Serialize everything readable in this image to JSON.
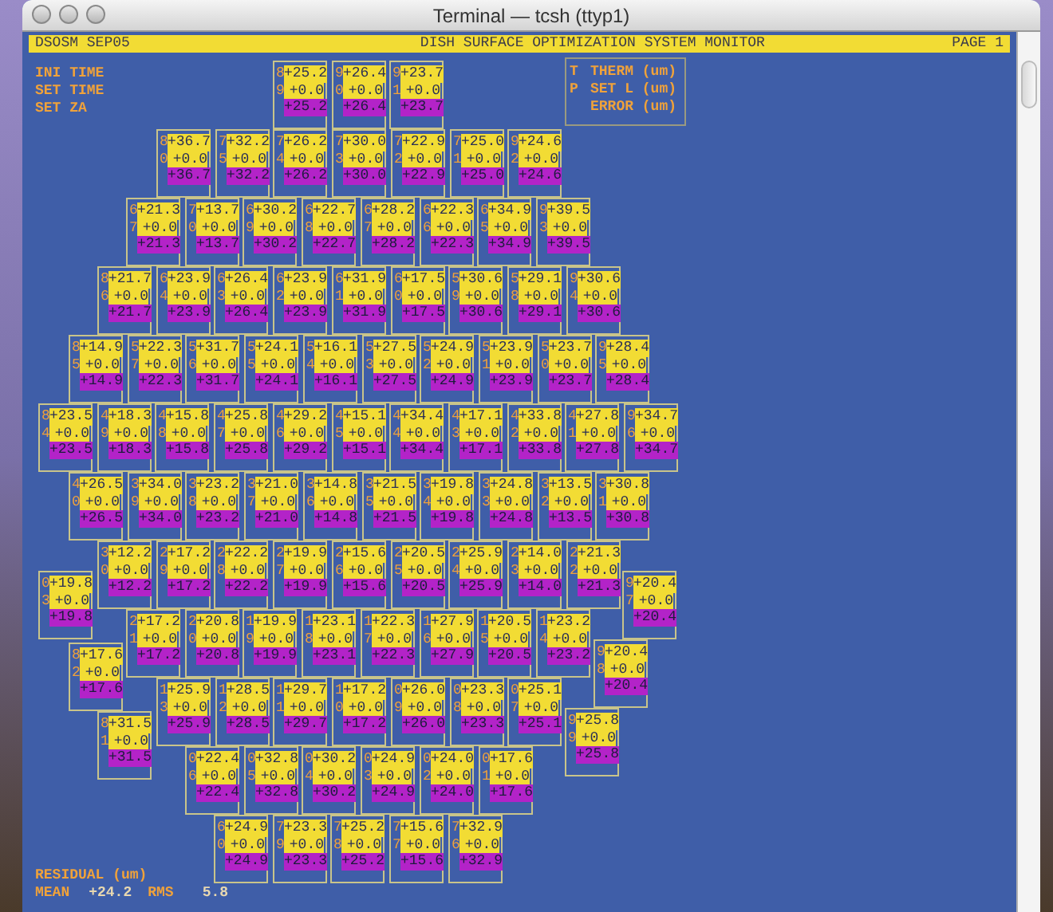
{
  "window": {
    "title": "Terminal — tcsh (ttyp1)"
  },
  "header": {
    "left": "DSOSM SEP05",
    "title": "DISH SURFACE OPTIMIZATION SYSTEM MONITOR",
    "page": "PAGE 1"
  },
  "info_labels": [
    "INI TIME",
    "SET TIME",
    "SET ZA"
  ],
  "legend": [
    {
      "key": "T",
      "label": "THERM (um)"
    },
    {
      "key": "P",
      "label": "SET L (um)"
    },
    {
      "label": "ERROR (um)"
    }
  ],
  "panel_rows": [
    [
      {
        "t": "8",
        "p": "9",
        "therm": "+25.2",
        "set": "+0.0",
        "error": "+25.2"
      },
      {
        "t": "9",
        "p": "0",
        "therm": "+26.4",
        "set": "+0.0",
        "error": "+26.4"
      },
      {
        "t": "9",
        "p": "1",
        "therm": "+23.7",
        "set": "+0.0",
        "error": "+23.7"
      }
    ],
    [
      {
        "t": "8",
        "p": "0",
        "therm": "+36.7",
        "set": "+0.0",
        "error": "+36.7"
      },
      {
        "t": "7",
        "p": "5",
        "therm": "+32.2",
        "set": "+0.0",
        "error": "+32.2"
      },
      {
        "t": "7",
        "p": "4",
        "therm": "+26.2",
        "set": "+0.0",
        "error": "+26.2"
      },
      {
        "t": "7",
        "p": "3",
        "therm": "+30.0",
        "set": "+0.0",
        "error": "+30.0"
      },
      {
        "t": "7",
        "p": "2",
        "therm": "+22.9",
        "set": "+0.0",
        "error": "+22.9"
      },
      {
        "t": "7",
        "p": "1",
        "therm": "+25.0",
        "set": "+0.0",
        "error": "+25.0"
      },
      {
        "t": "9",
        "p": "2",
        "therm": "+24.6",
        "set": "+0.0",
        "error": "+24.6"
      }
    ],
    [
      {
        "t": "6",
        "p": "7",
        "therm": "+21.3",
        "set": "+0.0",
        "error": "+21.3"
      },
      {
        "t": "7",
        "p": "0",
        "therm": "+13.7",
        "set": "+0.0",
        "error": "+13.7"
      },
      {
        "t": "6",
        "p": "9",
        "therm": "+30.2",
        "set": "+0.0",
        "error": "+30.2"
      },
      {
        "t": "6",
        "p": "8",
        "therm": "+22.7",
        "set": "+0.0",
        "error": "+22.7"
      },
      {
        "t": "6",
        "p": "7",
        "therm": "+28.2",
        "set": "+0.0",
        "error": "+28.2"
      },
      {
        "t": "6",
        "p": "6",
        "therm": "+22.3",
        "set": "+0.0",
        "error": "+22.3"
      },
      {
        "t": "6",
        "p": "5",
        "therm": "+34.9",
        "set": "+0.0",
        "error": "+34.9"
      },
      {
        "t": "9",
        "p": "3",
        "therm": "+39.5",
        "set": "+0.0",
        "error": "+39.5"
      }
    ],
    [
      {
        "t": "8",
        "p": "6",
        "therm": "+21.7",
        "set": "+0.0",
        "error": "+21.7"
      },
      {
        "t": "6",
        "p": "4",
        "therm": "+23.9",
        "set": "+0.0",
        "error": "+23.9"
      },
      {
        "t": "6",
        "p": "3",
        "therm": "+26.4",
        "set": "+0.0",
        "error": "+26.4"
      },
      {
        "t": "6",
        "p": "2",
        "therm": "+23.9",
        "set": "+0.0",
        "error": "+23.9"
      },
      {
        "t": "6",
        "p": "1",
        "therm": "+31.9",
        "set": "+0.0",
        "error": "+31.9"
      },
      {
        "t": "6",
        "p": "0",
        "therm": "+17.5",
        "set": "+0.0",
        "error": "+17.5"
      },
      {
        "t": "5",
        "p": "9",
        "therm": "+30.6",
        "set": "+0.0",
        "error": "+30.6"
      },
      {
        "t": "5",
        "p": "8",
        "therm": "+29.1",
        "set": "+0.0",
        "error": "+29.1"
      },
      {
        "t": "9",
        "p": "4",
        "therm": "+30.6",
        "set": "+0.0",
        "error": "+30.6"
      }
    ],
    [
      {
        "t": "8",
        "p": "5",
        "therm": "+14.9",
        "set": "+0.0",
        "error": "+14.9"
      },
      {
        "t": "5",
        "p": "7",
        "therm": "+22.3",
        "set": "+0.0",
        "error": "+22.3"
      },
      {
        "t": "5",
        "p": "6",
        "therm": "+31.7",
        "set": "+0.0",
        "error": "+31.7"
      },
      {
        "t": "5",
        "p": "5",
        "therm": "+24.1",
        "set": "+0.0",
        "error": "+24.1"
      },
      {
        "t": "5",
        "p": "4",
        "therm": "+16.1",
        "set": "+0.0",
        "error": "+16.1"
      },
      {
        "t": "5",
        "p": "3",
        "therm": "+27.5",
        "set": "+0.0",
        "error": "+27.5"
      },
      {
        "t": "5",
        "p": "2",
        "therm": "+24.9",
        "set": "+0.0",
        "error": "+24.9"
      },
      {
        "t": "5",
        "p": "1",
        "therm": "+23.9",
        "set": "+0.0",
        "error": "+23.9"
      },
      {
        "t": "5",
        "p": "0",
        "therm": "+23.7",
        "set": "+0.0",
        "error": "+23.7"
      },
      {
        "t": "9",
        "p": "5",
        "therm": "+28.4",
        "set": "+0.0",
        "error": "+28.4"
      }
    ],
    [
      {
        "t": "8",
        "p": "4",
        "therm": "+23.5",
        "set": "+0.0",
        "error": "+23.5"
      },
      {
        "t": "4",
        "p": "9",
        "therm": "+18.3",
        "set": "+0.0",
        "error": "+18.3"
      },
      {
        "t": "4",
        "p": "8",
        "therm": "+15.8",
        "set": "+0.0",
        "error": "+15.8"
      },
      {
        "t": "4",
        "p": "7",
        "therm": "+25.8",
        "set": "+0.0",
        "error": "+25.8"
      },
      {
        "t": "4",
        "p": "6",
        "therm": "+29.2",
        "set": "+0.0",
        "error": "+29.2"
      },
      {
        "t": "4",
        "p": "5",
        "therm": "+15.1",
        "set": "+0.0",
        "error": "+15.1"
      },
      {
        "t": "4",
        "p": "4",
        "therm": "+34.4",
        "set": "+0.0",
        "error": "+34.4"
      },
      {
        "t": "4",
        "p": "3",
        "therm": "+17.1",
        "set": "+0.0",
        "error": "+17.1"
      },
      {
        "t": "4",
        "p": "2",
        "therm": "+33.8",
        "set": "+0.0",
        "error": "+33.8"
      },
      {
        "t": "4",
        "p": "1",
        "therm": "+27.8",
        "set": "+0.0",
        "error": "+27.8"
      },
      {
        "t": "9",
        "p": "6",
        "therm": "+34.7",
        "set": "+0.0",
        "error": "+34.7"
      }
    ],
    [
      {
        "t": "4",
        "p": "0",
        "therm": "+26.5",
        "set": "+0.0",
        "error": "+26.5"
      },
      {
        "t": "3",
        "p": "9",
        "therm": "+34.0",
        "set": "+0.0",
        "error": "+34.0"
      },
      {
        "t": "3",
        "p": "8",
        "therm": "+23.2",
        "set": "+0.0",
        "error": "+23.2"
      },
      {
        "t": "3",
        "p": "7",
        "therm": "+21.0",
        "set": "+0.0",
        "error": "+21.0"
      },
      {
        "t": "3",
        "p": "6",
        "therm": "+14.8",
        "set": "+0.0",
        "error": "+14.8"
      },
      {
        "t": "3",
        "p": "5",
        "therm": "+21.5",
        "set": "+0.0",
        "error": "+21.5"
      },
      {
        "t": "3",
        "p": "4",
        "therm": "+19.8",
        "set": "+0.0",
        "error": "+19.8"
      },
      {
        "t": "3",
        "p": "3",
        "therm": "+24.8",
        "set": "+0.0",
        "error": "+24.8"
      },
      {
        "t": "3",
        "p": "2",
        "therm": "+13.5",
        "set": "+0.0",
        "error": "+13.5"
      },
      {
        "t": "3",
        "p": "1",
        "therm": "+30.8",
        "set": "+0.0",
        "error": "+30.8"
      }
    ],
    [
      {
        "t": "3",
        "p": "0",
        "therm": "+12.2",
        "set": "+0.0",
        "error": "+12.2"
      },
      {
        "t": "2",
        "p": "9",
        "therm": "+17.2",
        "set": "+0.0",
        "error": "+17.2"
      },
      {
        "t": "2",
        "p": "8",
        "therm": "+22.2",
        "set": "+0.0",
        "error": "+22.2"
      },
      {
        "t": "2",
        "p": "7",
        "therm": "+19.9",
        "set": "+0.0",
        "error": "+19.9"
      },
      {
        "t": "2",
        "p": "6",
        "therm": "+15.6",
        "set": "+0.0",
        "error": "+15.6"
      },
      {
        "t": "2",
        "p": "5",
        "therm": "+20.5",
        "set": "+0.0",
        "error": "+20.5"
      },
      {
        "t": "2",
        "p": "4",
        "therm": "+25.9",
        "set": "+0.0",
        "error": "+25.9"
      },
      {
        "t": "2",
        "p": "3",
        "therm": "+14.0",
        "set": "+0.0",
        "error": "+14.0"
      },
      {
        "t": "2",
        "p": "2",
        "therm": "+21.3",
        "set": "+0.0",
        "error": "+21.3"
      }
    ],
    [
      {
        "t": "2",
        "p": "1",
        "therm": "+17.2",
        "set": "+0.0",
        "error": "+17.2"
      },
      {
        "t": "2",
        "p": "0",
        "therm": "+20.8",
        "set": "+0.0",
        "error": "+20.8"
      },
      {
        "t": "1",
        "p": "9",
        "therm": "+19.9",
        "set": "+0.0",
        "error": "+19.9"
      },
      {
        "t": "1",
        "p": "8",
        "therm": "+23.1",
        "set": "+0.0",
        "error": "+23.1"
      },
      {
        "t": "1",
        "p": "7",
        "therm": "+22.3",
        "set": "+0.0",
        "error": "+22.3"
      },
      {
        "t": "1",
        "p": "6",
        "therm": "+27.9",
        "set": "+0.0",
        "error": "+27.9"
      },
      {
        "t": "1",
        "p": "5",
        "therm": "+20.5",
        "set": "+0.0",
        "error": "+20.5"
      },
      {
        "t": "1",
        "p": "4",
        "therm": "+23.2",
        "set": "+0.0",
        "error": "+23.2"
      }
    ],
    [
      {
        "t": "1",
        "p": "3",
        "therm": "+25.9",
        "set": "+0.0",
        "error": "+25.9"
      },
      {
        "t": "1",
        "p": "2",
        "therm": "+28.5",
        "set": "+0.0",
        "error": "+28.5"
      },
      {
        "t": "1",
        "p": "1",
        "therm": "+29.7",
        "set": "+0.0",
        "error": "+29.7"
      },
      {
        "t": "1",
        "p": "0",
        "therm": "+17.2",
        "set": "+0.0",
        "error": "+17.2"
      },
      {
        "t": "0",
        "p": "9",
        "therm": "+26.0",
        "set": "+0.0",
        "error": "+26.0"
      },
      {
        "t": "0",
        "p": "8",
        "therm": "+23.3",
        "set": "+0.0",
        "error": "+23.3"
      },
      {
        "t": "0",
        "p": "7",
        "therm": "+25.1",
        "set": "+0.0",
        "error": "+25.1"
      }
    ],
    [
      {
        "t": "0",
        "p": "6",
        "therm": "+22.4",
        "set": "+0.0",
        "error": "+22.4"
      },
      {
        "t": "0",
        "p": "5",
        "therm": "+32.8",
        "set": "+0.0",
        "error": "+32.8"
      },
      {
        "t": "0",
        "p": "4",
        "therm": "+30.2",
        "set": "+0.0",
        "error": "+30.2"
      },
      {
        "t": "0",
        "p": "3",
        "therm": "+24.9",
        "set": "+0.0",
        "error": "+24.9"
      },
      {
        "t": "0",
        "p": "2",
        "therm": "+24.0",
        "set": "+0.0",
        "error": "+24.0"
      },
      {
        "t": "0",
        "p": "1",
        "therm": "+17.6",
        "set": "+0.0",
        "error": "+17.6"
      }
    ],
    [
      {
        "t": "6",
        "p": "0",
        "therm": "+24.9",
        "set": "+0.0",
        "error": "+24.9"
      },
      {
        "t": "7",
        "p": "9",
        "therm": "+23.3",
        "set": "+0.0",
        "error": "+23.3"
      },
      {
        "t": "7",
        "p": "8",
        "therm": "+25.2",
        "set": "+0.0",
        "error": "+25.2"
      },
      {
        "t": "7",
        "p": "7",
        "therm": "+15.6",
        "set": "+0.0",
        "error": "+15.6"
      },
      {
        "t": "7",
        "p": "6",
        "therm": "+32.9",
        "set": "+0.0",
        "error": "+32.9"
      }
    ]
  ],
  "edge_panels": [
    {
      "t": "0",
      "p": "3",
      "therm": "+19.8",
      "set": "+0.0",
      "error": "+19.8"
    },
    {
      "t": "9",
      "p": "7",
      "therm": "+20.4",
      "set": "+0.0",
      "error": "+20.4"
    },
    {
      "t": "8",
      "p": "2",
      "therm": "+17.6",
      "set": "+0.0",
      "error": "+17.6"
    },
    {
      "t": "9",
      "p": "8",
      "therm": "+20.4",
      "set": "+0.0",
      "error": "+20.4"
    },
    {
      "t": "8",
      "p": "1",
      "therm": "+31.5",
      "set": "+0.0",
      "error": "+31.5"
    },
    {
      "t": "9",
      "p": "9",
      "therm": "+25.8",
      "set": "+0.0",
      "error": "+25.8"
    }
  ],
  "residual": {
    "title": "RESIDUAL (um)",
    "mean_label": "MEAN",
    "mean": "+24.2",
    "rms_label": "RMS",
    "rms": "5.8"
  }
}
